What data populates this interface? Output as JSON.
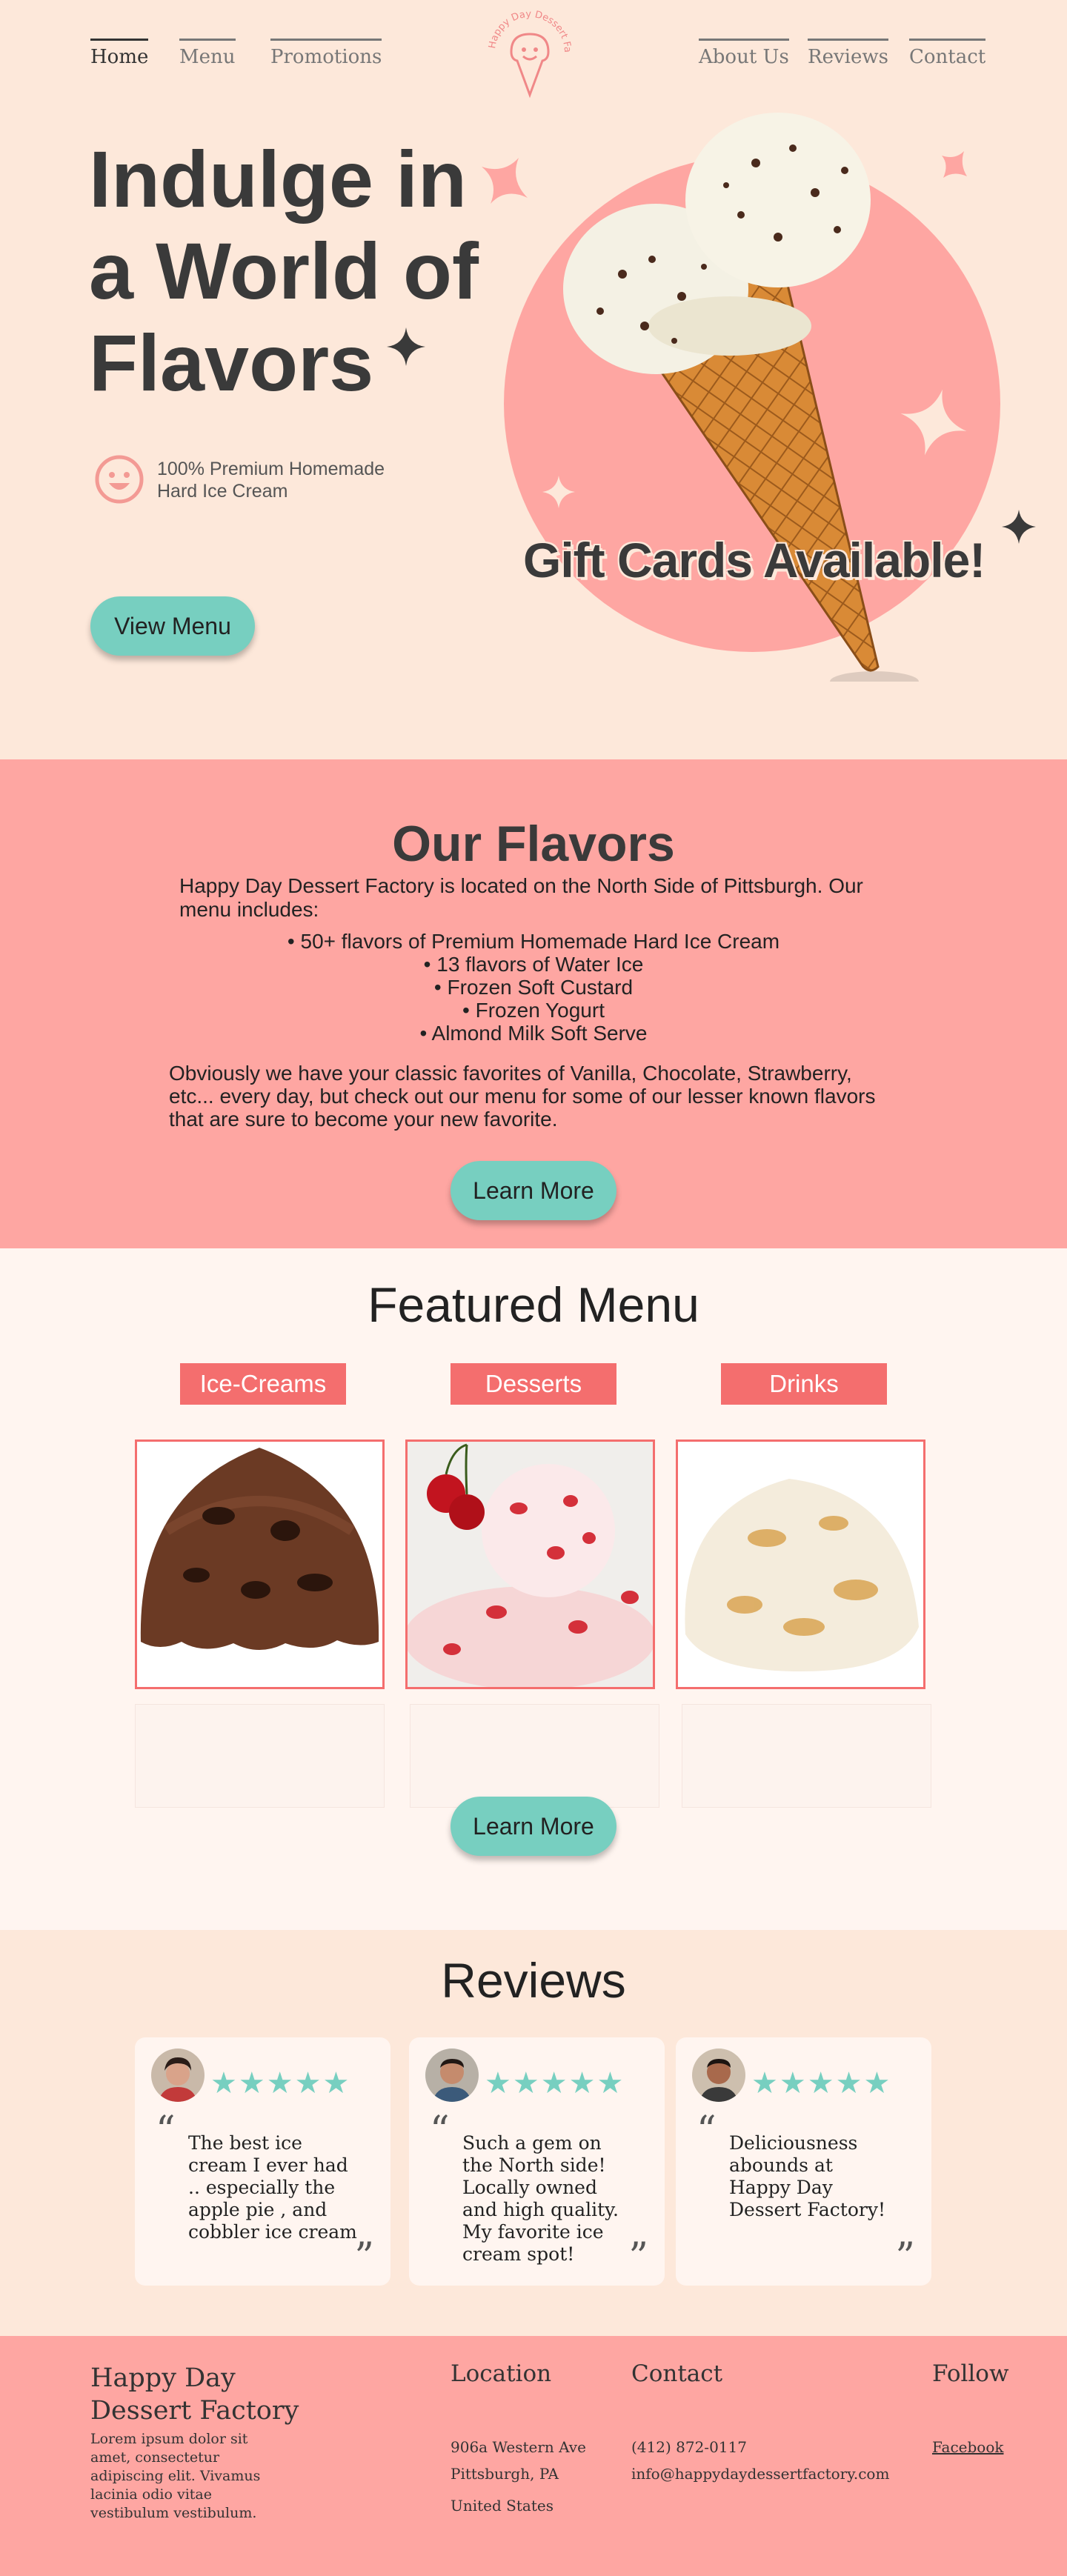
{
  "nav": {
    "left": [
      "Home",
      "Menu",
      "Promotions"
    ],
    "right": [
      "About Us",
      "Reviews",
      "Contact"
    ],
    "logo_text": "Happy Day Dessert Factory"
  },
  "hero": {
    "title_lines": [
      "Indulge in",
      "a World of",
      "Flavors"
    ],
    "tagline": "100% Premium Homemade Hard Ice Cream",
    "button": "View Menu",
    "gift": "Gift Cards Available!"
  },
  "flavors": {
    "title": "Our Flavors",
    "intro": "Happy Day Dessert Factory is located on the North Side of Pittsburgh. Our menu includes:",
    "items": [
      "50+ flavors of Premium Homemade Hard Ice Cream",
      "13 flavors of Water Ice",
      "Frozen Soft Custard",
      "Frozen Yogurt",
      "Almond Milk Soft Serve"
    ],
    "outro": "Obviously we have your classic favorites of Vanilla, Chocolate, Strawberry, etc... every day, but check out our menu for some of our lesser known flavors that are sure to become your new favorite.",
    "button": "Learn More"
  },
  "featured": {
    "title": "Featured Menu",
    "tabs": [
      "Ice-Creams",
      "Desserts",
      "Drinks"
    ],
    "button": "Learn More"
  },
  "reviews": {
    "title": "Reviews",
    "stars": "★★★★★",
    "items": [
      {
        "text": "The best ice cream I ever had .. especially the apple pie , and cobbler ice cream"
      },
      {
        "text": "Such a gem on the North side! Locally owned and high quality. My favorite ice cream spot!"
      },
      {
        "text": "Deliciousness abounds at Happy Day Dessert Factory!"
      }
    ]
  },
  "footer": {
    "brand": "Happy Day Dessert Factory",
    "brand_text": "Lorem ipsum dolor sit amet, consectetur adipiscing elit. Vivamus lacinia odio vitae vestibulum vestibulum.",
    "location_title": "Location",
    "location_lines": [
      "906a Western Ave",
      "Pittsburgh, PA",
      "United States"
    ],
    "contact_title": "Contact",
    "phone": "(412) 872-0117",
    "email": "info@happydaydessertfactory.com",
    "follow_title": "Follow",
    "facebook": "Facebook"
  },
  "colors": {
    "background": "#fde8da",
    "pink": "#fea6a2",
    "coral": "#f46e6e",
    "teal": "#77cfc0",
    "dark": "#3a3a3a"
  }
}
